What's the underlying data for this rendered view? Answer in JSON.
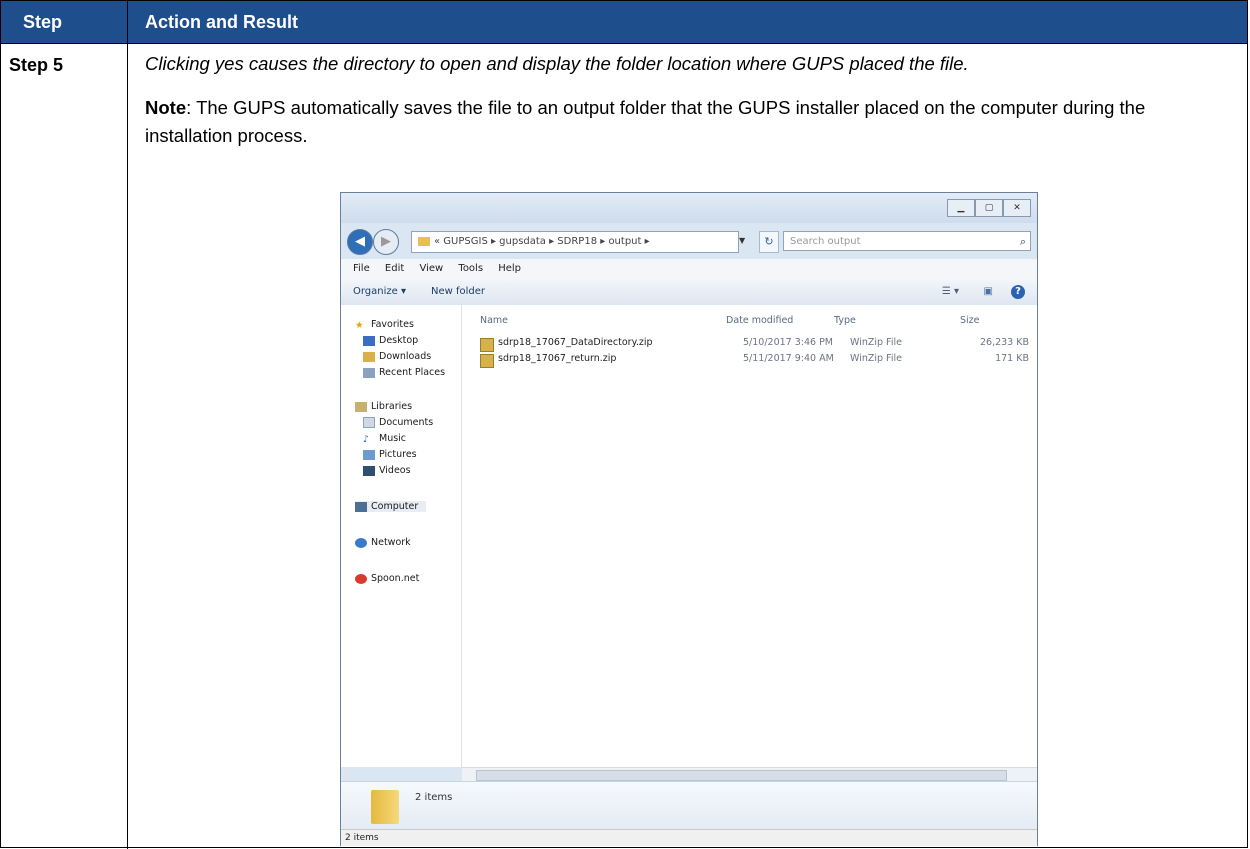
{
  "table": {
    "header_step": "Step",
    "header_action": "Action and Result",
    "step_label": "Step 5",
    "intro_text": "Clicking yes causes the directory to open and display the folder location where GUPS placed the file.",
    "note_label": "Note",
    "note_text": ":  The GUPS automatically saves the file to an output folder that the GUPS installer placed on the computer during the installation process."
  },
  "explorer": {
    "address_path": "« GUPSGIS ▸ gupsdata ▸ SDRP18 ▸ output ▸",
    "search_placeholder": "Search output",
    "menu": [
      "File",
      "Edit",
      "View",
      "Tools",
      "Help"
    ],
    "organize_label": "Organize ▾",
    "new_folder_label": "New folder",
    "nav": {
      "favorites": "Favorites",
      "desktop": "Desktop",
      "downloads": "Downloads",
      "recent": "Recent Places",
      "libraries": "Libraries",
      "documents": "Documents",
      "music": "Music",
      "pictures": "Pictures",
      "videos": "Videos",
      "computer": "Computer",
      "network": "Network",
      "spoon": "Spoon.net"
    },
    "columns": {
      "name": "Name",
      "date": "Date modified",
      "type": "Type",
      "size": "Size"
    },
    "files": [
      {
        "name": "sdrp18_17067_DataDirectory.zip",
        "date": "5/10/2017 3:46 PM",
        "type": "WinZip File",
        "size": "26,233 KB"
      },
      {
        "name": "sdrp18_17067_return.zip",
        "date": "5/11/2017 9:40 AM",
        "type": "WinZip File",
        "size": "171 KB"
      }
    ],
    "details_count": "2 items",
    "status_count": "2 items"
  }
}
